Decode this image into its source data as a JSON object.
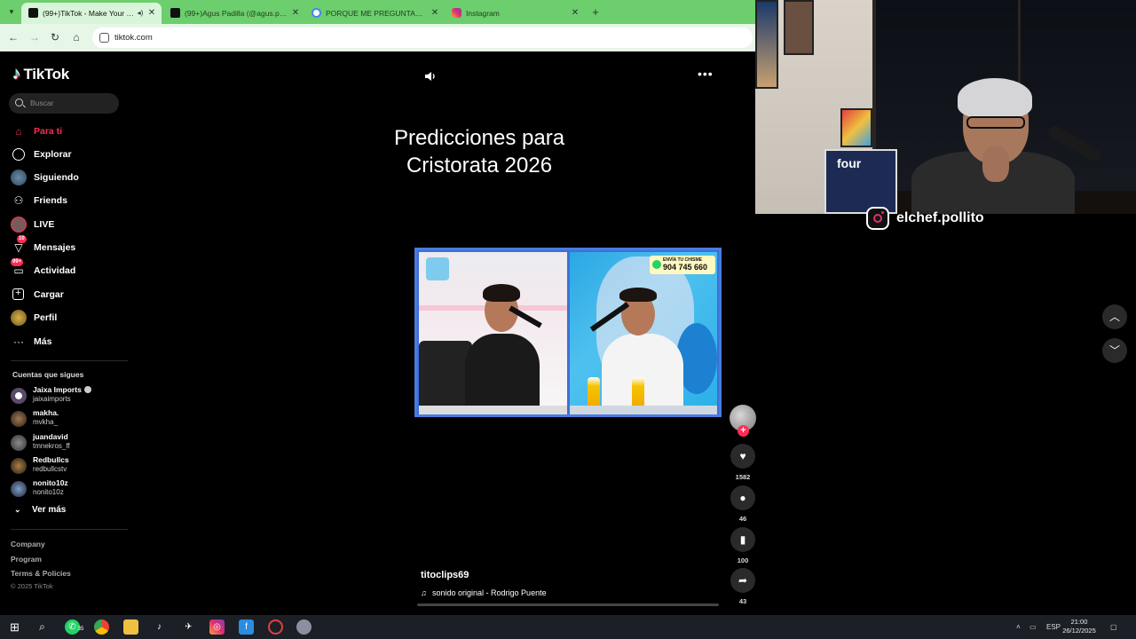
{
  "browser": {
    "tabs": [
      {
        "title": "(99+)TikTok - Make Your Day",
        "favicon": "tiktok-icon",
        "active": true
      },
      {
        "title": "(99+)Agus Padilla (@agus.padilla)",
        "favicon": "tiktok-icon",
        "active": false
      },
      {
        "title": "PORQUE ME PREGUNTAN SI CHAMO",
        "favicon": "google-icon",
        "active": false
      },
      {
        "title": "Instagram",
        "favicon": "instagram-icon",
        "active": false
      }
    ],
    "new_tab": "+",
    "url": "tiktok.com"
  },
  "sidebar": {
    "brand": "TikTok",
    "search_placeholder": "Buscar",
    "nav": [
      {
        "label": "Para ti",
        "icon": "home-icon",
        "active": true
      },
      {
        "label": "Explorar",
        "icon": "compass-icon"
      },
      {
        "label": "Siguiendo",
        "icon": "following-avatar-icon"
      },
      {
        "label": "Friends",
        "icon": "friends-icon"
      },
      {
        "label": "LIVE",
        "icon": "live-icon"
      },
      {
        "label": "Mensajes",
        "icon": "messages-icon",
        "badge": "10"
      },
      {
        "label": "Actividad",
        "icon": "activity-icon",
        "badge": "99+"
      },
      {
        "label": "Cargar",
        "icon": "upload-icon"
      },
      {
        "label": "Perfil",
        "icon": "profile-icon"
      },
      {
        "label": "Más",
        "icon": "more-icon"
      }
    ],
    "following_title": "Cuentas que sigues",
    "following": [
      {
        "name": "Jaixa Imports",
        "handle": "jaixaimports",
        "verified": true
      },
      {
        "name": "makha.",
        "handle": "mvkha_"
      },
      {
        "name": "juandavid",
        "handle": "tmnekros_ff"
      },
      {
        "name": "Redbullcs",
        "handle": "redbullcstv"
      },
      {
        "name": "nonito10z",
        "handle": "nonito10z"
      }
    ],
    "see_more": "Ver más",
    "footer": [
      "Company",
      "Program",
      "Terms & Policies"
    ],
    "copyright": "© 2025 TikTok"
  },
  "video": {
    "title_line1": "Predicciones para",
    "title_line2": "Cristorata 2026",
    "overlay_line1": "ENVÍA TU CHISME",
    "overlay_line2": "904 745 660",
    "author": "titoclips69",
    "sound": "sonido original - Rodrigo Puente",
    "progress": 0.0,
    "likes": "1582",
    "comments": "46",
    "saves": "100",
    "shares": "43"
  },
  "stream": {
    "fridge_text": "four",
    "instagram_handle": "elchef.pollito"
  },
  "taskbar": {
    "whatsapp_badge": "35",
    "lang": "ESP",
    "time": "21:00",
    "date": "26/12/2025"
  }
}
